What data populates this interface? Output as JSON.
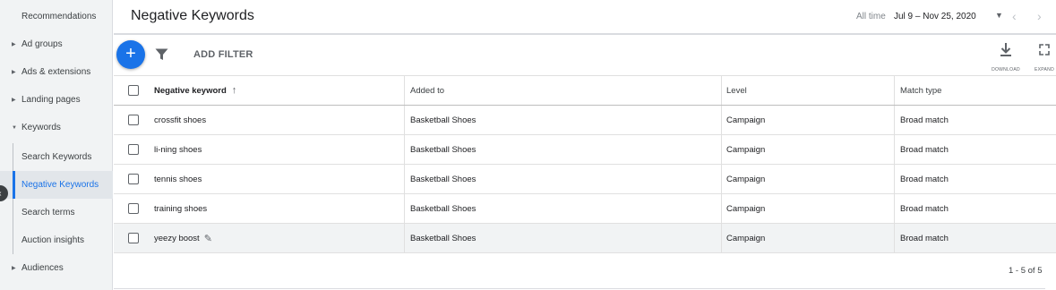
{
  "sidebar": {
    "items": [
      {
        "label": "Recommendations",
        "has_caret": false
      },
      {
        "label": "Ad groups",
        "has_caret": true
      },
      {
        "label": "Ads & extensions",
        "has_caret": true
      },
      {
        "label": "Landing pages",
        "has_caret": true
      },
      {
        "label": "Keywords",
        "has_caret": true,
        "expanded": true
      },
      {
        "label": "Search Keywords",
        "sub": true
      },
      {
        "label": "Negative Keywords",
        "sub": true,
        "active": true
      },
      {
        "label": "Search terms",
        "sub": true
      },
      {
        "label": "Auction insights",
        "sub": true
      },
      {
        "label": "Audiences",
        "has_caret": true
      }
    ]
  },
  "header": {
    "title": "Negative Keywords",
    "date_label": "All time",
    "date_range": "Jul 9 – Nov 25, 2020"
  },
  "toolbar": {
    "add_filter_label": "ADD FILTER",
    "download_label": "DOWNLOAD",
    "expand_label": "EXPAND"
  },
  "table": {
    "columns": [
      "Negative keyword",
      "Added to",
      "Level",
      "Match type"
    ],
    "rows": [
      {
        "keyword": "crossfit shoes",
        "added_to": "Basketball Shoes",
        "level": "Campaign",
        "match_type": "Broad match"
      },
      {
        "keyword": "li-ning shoes",
        "added_to": "Basketball Shoes",
        "level": "Campaign",
        "match_type": "Broad match"
      },
      {
        "keyword": "tennis shoes",
        "added_to": "Basketball Shoes",
        "level": "Campaign",
        "match_type": "Broad match"
      },
      {
        "keyword": "training shoes",
        "added_to": "Basketball Shoes",
        "level": "Campaign",
        "match_type": "Broad match"
      },
      {
        "keyword": "yeezy boost",
        "added_to": "Basketball Shoes",
        "level": "Campaign",
        "match_type": "Broad match"
      }
    ]
  },
  "pagination": {
    "text": "1 - 5 of 5"
  },
  "colors": {
    "accent": "#1a73e8",
    "sidebar_bg": "#f1f3f4"
  }
}
